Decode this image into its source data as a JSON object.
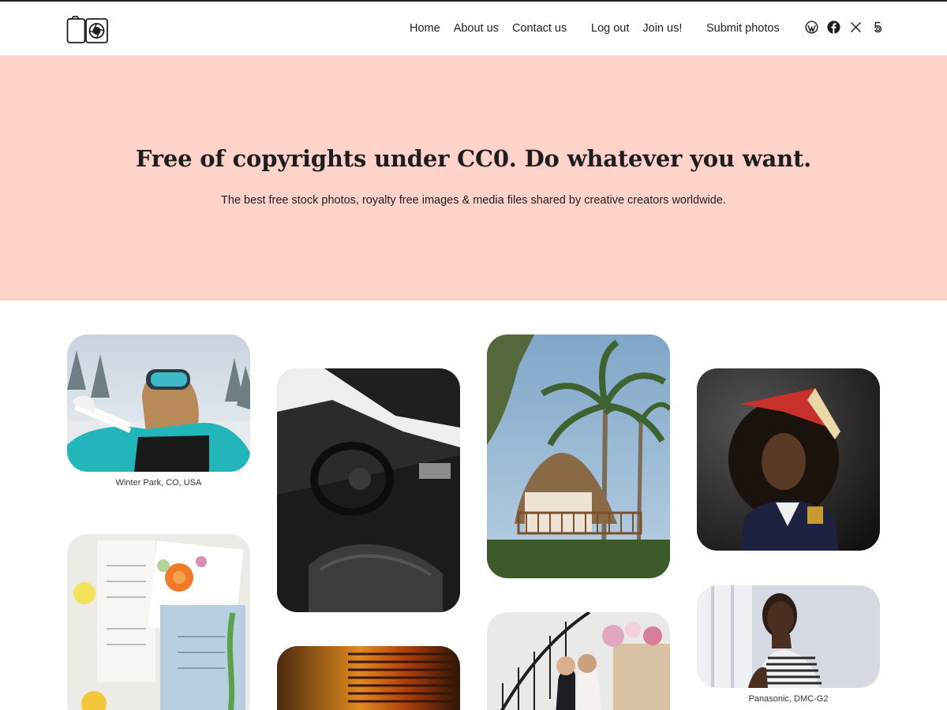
{
  "nav": {
    "home": "Home",
    "about": "About us",
    "contact": "Contact us",
    "logout": "Log out",
    "join": "Join us!",
    "submit": "Submit photos"
  },
  "social": [
    "wordpress-icon",
    "facebook-icon",
    "x-icon",
    "500px-icon"
  ],
  "hero": {
    "title": "Free of copyrights under CC0. Do whatever you want.",
    "subtitle": "The best free stock photos, royalty free images & media files shared by creative creators worldwide."
  },
  "photos": {
    "skier": {
      "caption": "Winter Park, CO, USA"
    },
    "portrait_woman": {
      "caption": "Panasonic, DMC-G2"
    }
  },
  "colors": {
    "hero_bg": "#ffd3ca",
    "text": "#1e1e1e"
  }
}
